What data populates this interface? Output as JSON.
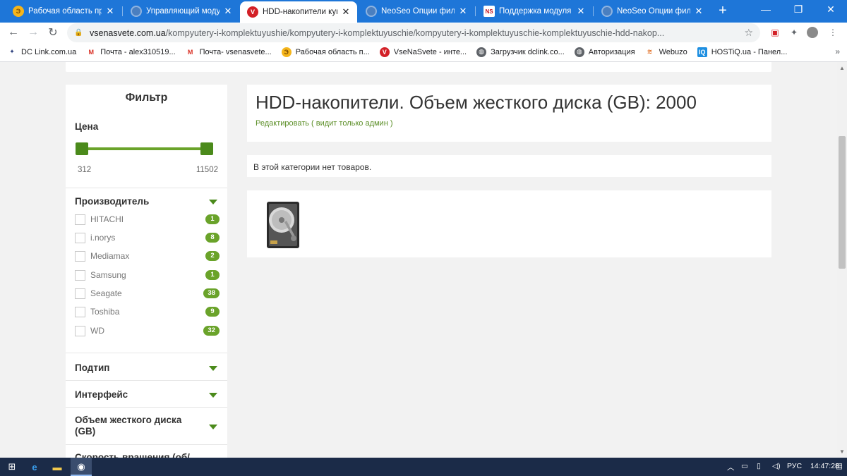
{
  "browser": {
    "tabs": [
      {
        "title": "Рабочая область прое",
        "icon": "yellow-circle-icon"
      },
      {
        "title": "Управляющий модуль",
        "icon": "globe-icon"
      },
      {
        "title": "HDD-накопители купи",
        "icon": "vsenasvete-icon"
      },
      {
        "title": "NeoSeo Опции фильтр",
        "icon": "globe-icon"
      },
      {
        "title": "Поддержка модуля [SE",
        "icon": "neoseo-icon"
      },
      {
        "title": "NeoSeo Опции фильтр",
        "icon": "globe-icon"
      }
    ],
    "url_host": "vsenasvete.com.ua",
    "url_path": "/kompyutery-i-komplektuyushie/kompyutery-i-komplektuyuschie/kompyutery-i-komplektuyuschie-komplektuyuschie-hdd-nakop...",
    "bookmarks": [
      {
        "label": "DC Link.com.ua",
        "icon": "dclink-icon"
      },
      {
        "label": "Почта - alex310519...",
        "icon": "gmail-icon"
      },
      {
        "label": "Почта- vsenasvete...",
        "icon": "gmail-icon"
      },
      {
        "label": "Рабочая область п...",
        "icon": "yellow-circle-icon"
      },
      {
        "label": "VseNaSvete - инте...",
        "icon": "vsenasvete-icon"
      },
      {
        "label": "Загрузчик dclink.co...",
        "icon": "globe-icon"
      },
      {
        "label": "Авторизация",
        "icon": "globe-icon"
      },
      {
        "label": "Webuzo",
        "icon": "webuzo-icon"
      },
      {
        "label": "HOSTiQ.ua - Панел...",
        "icon": "hostiq-icon"
      }
    ]
  },
  "filter": {
    "title": "Фильтр",
    "price_label": "Цена",
    "price_min": "312",
    "price_max": "11502",
    "manufacturer_label": "Производитель",
    "brands": [
      {
        "name": "HITACHI",
        "count": "1"
      },
      {
        "name": "i.norys",
        "count": "8"
      },
      {
        "name": "Mediamax",
        "count": "2"
      },
      {
        "name": "Samsung",
        "count": "1"
      },
      {
        "name": "Seagate",
        "count": "38"
      },
      {
        "name": "Toshiba",
        "count": "9"
      },
      {
        "name": "WD",
        "count": "32"
      }
    ],
    "sections": [
      {
        "label": "Подтип"
      },
      {
        "label": "Интерфейс"
      },
      {
        "label": "Объем жесткого диска (GB)"
      },
      {
        "label": "Скорость вращения (об/"
      }
    ],
    "accent_color": "#6aa32a"
  },
  "content": {
    "title": "HDD-накопители. Объем жесткого диска (GB): 2000",
    "admin_link": "Редактировать ( видит только админ )",
    "empty_message": "В этой категории нет товаров."
  },
  "taskbar": {
    "lang": "РУС",
    "time": "14:47:28"
  }
}
